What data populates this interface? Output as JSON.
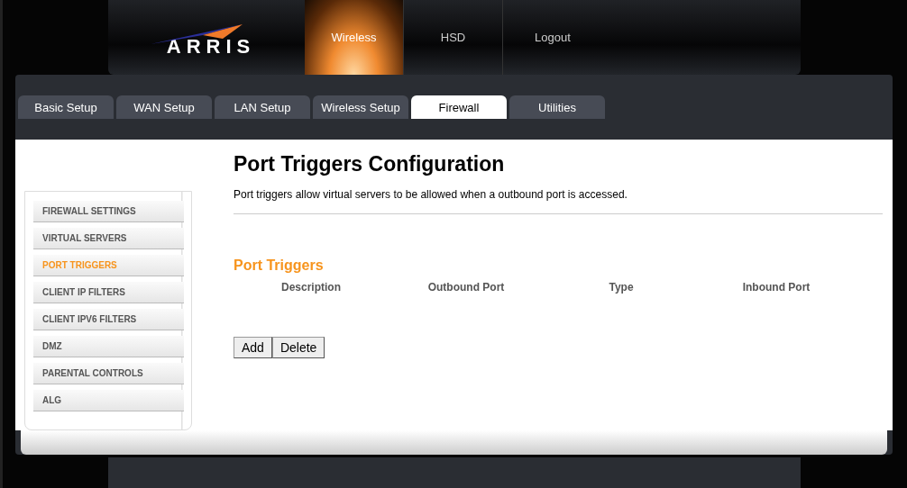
{
  "logo": {
    "text": "ARRIS"
  },
  "top_nav": [
    {
      "label": "Wireless",
      "selected": true
    },
    {
      "label": "HSD",
      "selected": false
    },
    {
      "label": "Logout",
      "selected": false
    }
  ],
  "tabs": [
    {
      "label": "Basic Setup",
      "selected": false
    },
    {
      "label": "WAN Setup",
      "selected": false
    },
    {
      "label": "LAN Setup",
      "selected": false
    },
    {
      "label": "Wireless Setup",
      "selected": false
    },
    {
      "label": "Firewall",
      "selected": true
    },
    {
      "label": "Utilities",
      "selected": false
    }
  ],
  "sidebar": {
    "items": [
      {
        "label": "FIREWALL SETTINGS",
        "selected": false
      },
      {
        "label": "VIRTUAL SERVERS",
        "selected": false
      },
      {
        "label": "PORT TRIGGERS",
        "selected": true
      },
      {
        "label": "CLIENT IP FILTERS",
        "selected": false
      },
      {
        "label": "CLIENT IPV6 FILTERS",
        "selected": false
      },
      {
        "label": "DMZ",
        "selected": false
      },
      {
        "label": "PARENTAL CONTROLS",
        "selected": false
      },
      {
        "label": "ALG",
        "selected": false
      }
    ]
  },
  "page": {
    "title": "Port Triggers Configuration",
    "description": "Port triggers allow virtual servers to be allowed when a outbound port is accessed.",
    "section_title": "Port Triggers"
  },
  "table": {
    "columns": [
      "Description",
      "Outbound Port",
      "Type",
      "Inbound Port"
    ]
  },
  "buttons": [
    "Add",
    "Delete"
  ]
}
